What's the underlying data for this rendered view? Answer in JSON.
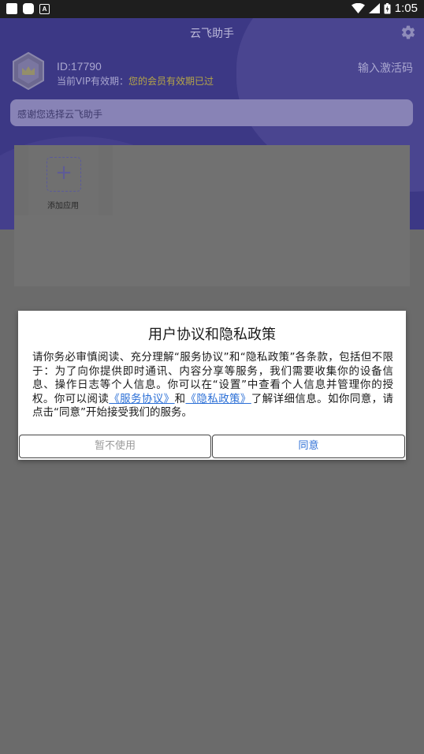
{
  "statusbar": {
    "time": "1:05",
    "icon_a": "A"
  },
  "header": {
    "title": "云飞助手",
    "user_id": "ID:17790",
    "vip_label": "当前VIP有效期：",
    "vip_status": "您的会员有效期已过",
    "activate": "输入激活码"
  },
  "notice": {
    "text": "感谢您选择云飞助手"
  },
  "apps": {
    "add_label": "添加应用"
  },
  "dialog": {
    "title": "用户协议和隐私政策",
    "body_1": "请你务必审慎阅读、充分理解“服务协议”和“隐私政策”各条款，包括但不限于：为了向你提供即时通讯、内容分享等服务，我们需要收集你的设备信息、操作日志等个人信息。你可以在“设置”中查看个人信息并管理你的授权。你可以阅读",
    "link_service": "《服务协议》",
    "body_and": "和",
    "link_privacy": "《隐私政策》",
    "body_2": "了解详细信息。如你同意，请点击“同意”开始接受我们的服务。",
    "decline": "暂不使用",
    "agree": "同意"
  },
  "colors": {
    "header_bg": "#3c3885",
    "overlay": "#6b6b6b",
    "link": "#2b6fd6"
  }
}
